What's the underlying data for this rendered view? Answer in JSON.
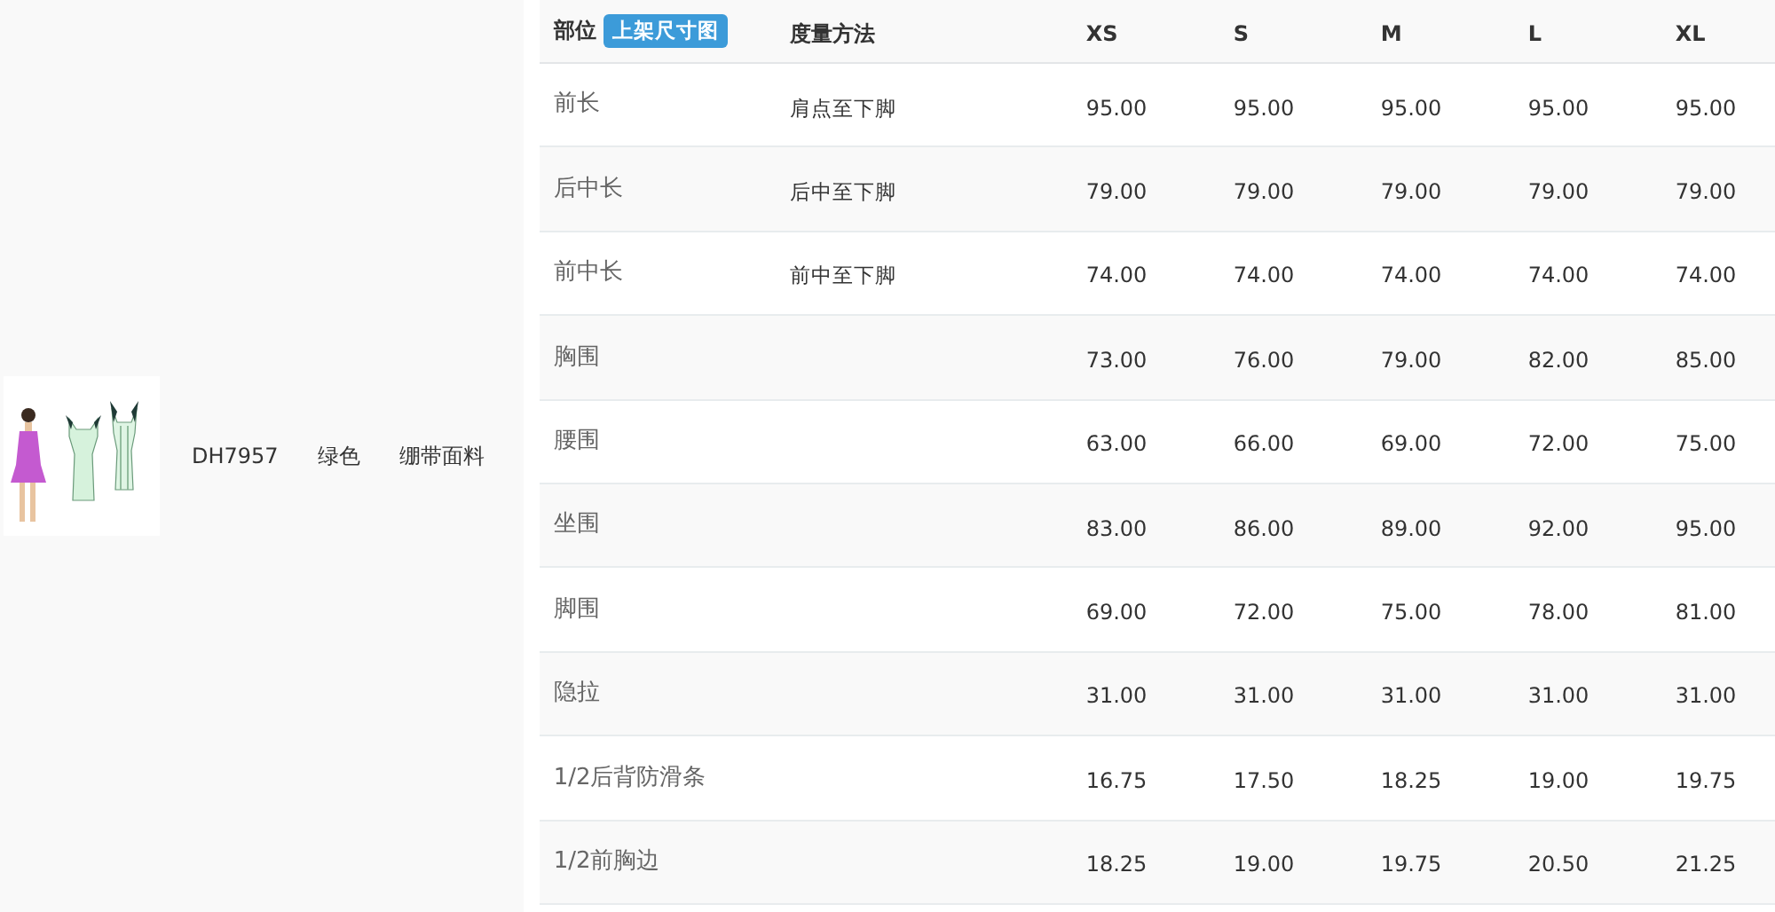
{
  "product": {
    "code": "DH7957",
    "color_name": "绿色",
    "fabric": "绷带面料"
  },
  "size_table": {
    "part_header": "部位",
    "size_chart_button": "上架尺寸图",
    "method_header": "度量方法",
    "sizes": [
      "XS",
      "S",
      "M",
      "L",
      "XL"
    ],
    "rows": [
      {
        "part": "前长",
        "method": "肩点至下脚",
        "values": [
          "95.00",
          "95.00",
          "95.00",
          "95.00",
          "95.00"
        ]
      },
      {
        "part": "后中长",
        "method": "后中至下脚",
        "values": [
          "79.00",
          "79.00",
          "79.00",
          "79.00",
          "79.00"
        ]
      },
      {
        "part": "前中长",
        "method": "前中至下脚",
        "values": [
          "74.00",
          "74.00",
          "74.00",
          "74.00",
          "74.00"
        ]
      },
      {
        "part": "胸围",
        "values": [
          "73.00",
          "76.00",
          "79.00",
          "82.00",
          "85.00"
        ]
      },
      {
        "part": "腰围",
        "values": [
          "63.00",
          "66.00",
          "69.00",
          "72.00",
          "75.00"
        ]
      },
      {
        "part": "坐围",
        "values": [
          "83.00",
          "86.00",
          "89.00",
          "92.00",
          "95.00"
        ]
      },
      {
        "part": "脚围",
        "values": [
          "69.00",
          "72.00",
          "75.00",
          "78.00",
          "81.00"
        ]
      },
      {
        "part": "隐拉",
        "values": [
          "31.00",
          "31.00",
          "31.00",
          "31.00",
          "31.00"
        ]
      },
      {
        "part": "1/2后背防滑条",
        "values": [
          "16.75",
          "17.50",
          "18.25",
          "19.00",
          "19.75"
        ]
      },
      {
        "part": "1/2前胸边",
        "values": [
          "18.25",
          "19.00",
          "19.75",
          "20.50",
          "21.25"
        ]
      }
    ]
  }
}
